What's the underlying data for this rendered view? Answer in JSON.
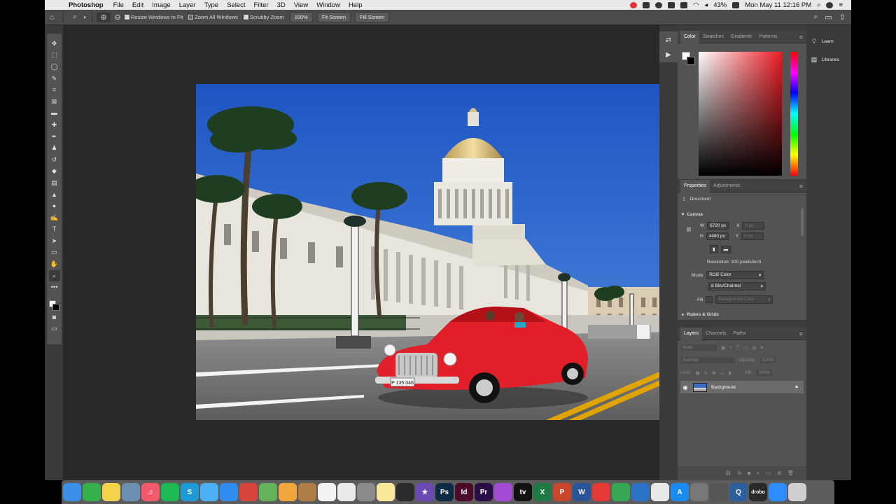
{
  "menubar": {
    "app_name": "Photoshop",
    "items": [
      "File",
      "Edit",
      "Image",
      "Layer",
      "Type",
      "Select",
      "Filter",
      "3D",
      "View",
      "Window",
      "Help"
    ],
    "battery": "43%",
    "clock": "Mon May 11  12:16 PM"
  },
  "options_bar": {
    "resize_windows_label": "Resize Windows to Fit",
    "zoom_all_windows_label": "Zoom All Windows",
    "scrubby_zoom_label": "Scrubby Zoom",
    "zoom_value": "100%",
    "fit_screen_label": "Fit Screen",
    "fill_screen_label": "Fill Screen"
  },
  "color_panel": {
    "tabs": [
      "Color",
      "Swatches",
      "Gradients",
      "Patterns"
    ]
  },
  "properties_panel": {
    "tabs": [
      "Properties",
      "Adjustments"
    ],
    "document_label": "Document",
    "canvas_label": "Canvas",
    "w_label": "W",
    "w_value": "6720 px",
    "x_label": "X",
    "x_placeholder": "0 px",
    "h_label": "H",
    "h_value": "4480 px",
    "y_label": "Y",
    "y_placeholder": "0 px",
    "resolution": "Resolution: 300 pixels/inch",
    "mode_label": "Mode",
    "mode_value": "RGB Color",
    "depth_value": "8 Bits/Channel",
    "fill_label": "Fill",
    "fill_value": "Background Color",
    "rulers_label": "Rulers & Grids"
  },
  "layers_panel": {
    "tabs": [
      "Layers",
      "Channels",
      "Paths"
    ],
    "kind_placeholder": "Kind",
    "blend_mode": "Normal",
    "opacity_label": "Opacity:",
    "opacity_value": "100%",
    "lock_label": "Lock:",
    "fill_label": "Fill:",
    "fill_value": "100%",
    "layer_name": "Background"
  },
  "learn_strip": {
    "learn_label": "Learn",
    "libraries_label": "Libraries"
  },
  "photo": {
    "license_plate": "P 135 046"
  },
  "dock": {
    "apps": [
      {
        "icon": "finder-icon",
        "color": "#3b8fe6",
        "glyph": ""
      },
      {
        "icon": "facetime-icon",
        "color": "#35b04a",
        "glyph": ""
      },
      {
        "icon": "notes-stickies-icon",
        "color": "#f2d24a",
        "glyph": ""
      },
      {
        "icon": "preview-icon",
        "color": "#6d8fb0",
        "glyph": ""
      },
      {
        "icon": "music-icon",
        "color": "#f25a6b",
        "glyph": "♫"
      },
      {
        "icon": "spotify-icon",
        "color": "#1db954",
        "glyph": ""
      },
      {
        "icon": "skype-icon",
        "color": "#1e9bd7",
        "glyph": "S"
      },
      {
        "icon": "messages-icon",
        "color": "#4cb0f5",
        "glyph": ""
      },
      {
        "icon": "safari-icon",
        "color": "#2f8cf0",
        "glyph": ""
      },
      {
        "icon": "chrome-icon",
        "color": "#d8453c",
        "glyph": ""
      },
      {
        "icon": "maps-icon",
        "color": "#64b35a",
        "glyph": ""
      },
      {
        "icon": "photos-icon",
        "color": "#f0a63c",
        "glyph": ""
      },
      {
        "icon": "notebook-icon",
        "color": "#b07d45",
        "glyph": ""
      },
      {
        "icon": "calendar-icon",
        "color": "#f3f3f3",
        "glyph": ""
      },
      {
        "icon": "reminders-icon",
        "color": "#eaeaea",
        "glyph": ""
      },
      {
        "icon": "settings-gear-icon",
        "color": "#8a8a8a",
        "glyph": ""
      },
      {
        "icon": "stickies-icon",
        "color": "#f7e89a",
        "glyph": ""
      },
      {
        "icon": "obs-icon",
        "color": "#2b2b2b",
        "glyph": ""
      },
      {
        "icon": "imovie-star-icon",
        "color": "#6c4ab3",
        "glyph": "★"
      },
      {
        "icon": "photoshop-icon",
        "color": "#0f2a45",
        "glyph": "Ps"
      },
      {
        "icon": "indesign-icon",
        "color": "#4d0b2a",
        "glyph": "Id"
      },
      {
        "icon": "premiere-icon",
        "color": "#2a0d45",
        "glyph": "Pr"
      },
      {
        "icon": "podcasts-icon",
        "color": "#a44bd6",
        "glyph": ""
      },
      {
        "icon": "apple-tv-icon",
        "color": "#111111",
        "glyph": "tv"
      },
      {
        "icon": "excel-icon",
        "color": "#1e7a43",
        "glyph": "X"
      },
      {
        "icon": "powerpoint-icon",
        "color": "#c9462a",
        "glyph": "P"
      },
      {
        "icon": "word-icon",
        "color": "#2a5699",
        "glyph": "W"
      },
      {
        "icon": "do-not-disturb-icon",
        "color": "#e53935",
        "glyph": ""
      },
      {
        "icon": "numbers-icon",
        "color": "#36a853",
        "glyph": ""
      },
      {
        "icon": "keynote-icon",
        "color": "#2d73c5",
        "glyph": ""
      },
      {
        "icon": "textedit-icon",
        "color": "#e8e8e8",
        "glyph": ""
      },
      {
        "icon": "app-store-icon",
        "color": "#1a8bf0",
        "glyph": "A"
      },
      {
        "icon": "disk-utility-icon",
        "color": "#777777",
        "glyph": ""
      },
      {
        "icon": "screenshot-icon",
        "color": "#555555",
        "glyph": ""
      },
      {
        "icon": "quicktime-icon",
        "color": "#2c5f9e",
        "glyph": "Q"
      },
      {
        "icon": "drobo-icon",
        "color": "#2a2a2a",
        "glyph": "drobo"
      },
      {
        "icon": "zoom-icon",
        "color": "#2d8cff",
        "glyph": ""
      },
      {
        "icon": "trash-icon",
        "color": "#cfcfcf",
        "glyph": ""
      }
    ]
  }
}
